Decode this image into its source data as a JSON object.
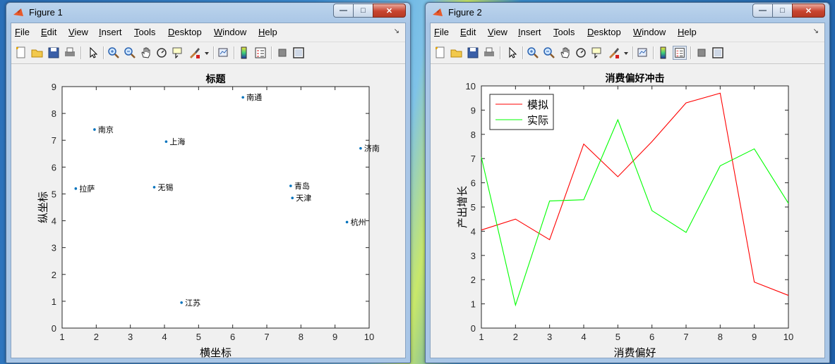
{
  "menu": {
    "items": [
      {
        "key": "F",
        "rest": "ile"
      },
      {
        "key": "E",
        "rest": "dit"
      },
      {
        "key": "V",
        "rest": "iew"
      },
      {
        "key": "I",
        "rest": "nsert"
      },
      {
        "key": "T",
        "rest": "ools"
      },
      {
        "key": "D",
        "rest": "esktop"
      },
      {
        "key": "W",
        "rest": "indow"
      },
      {
        "key": "H",
        "rest": "elp"
      }
    ]
  },
  "window1": {
    "title": "Figure 1",
    "caption": {
      "minimize": "—",
      "maximize": "□",
      "close": "✕"
    }
  },
  "window2": {
    "title": "Figure 2",
    "caption": {
      "minimize": "—",
      "maximize": "□",
      "close": "✕"
    }
  },
  "toolbar_icons": [
    "new-figure-icon",
    "open-file-icon",
    "save-icon",
    "print-icon",
    "edit-plot-arrow-icon",
    "zoom-in-icon",
    "zoom-out-icon",
    "pan-hand-icon",
    "rotate-3d-icon",
    "data-cursor-icon",
    "brush-icon",
    "brush-dropdown-icon",
    "link-plot-icon",
    "colorbar-icon",
    "legend-icon",
    "hide-plot-tools-icon",
    "show-plot-tools-icon"
  ],
  "colors": {
    "series_sim": "#ff0000",
    "series_real": "#00ff00",
    "scatter": "#0072bd",
    "axis": "#262626"
  },
  "chart_data": [
    {
      "type": "scatter",
      "title": "标题",
      "xlabel": "横坐标",
      "ylabel": "纵坐标",
      "xlim": [
        1,
        10
      ],
      "ylim": [
        0,
        9
      ],
      "xticks": [
        1,
        2,
        3,
        4,
        5,
        6,
        7,
        8,
        9,
        10
      ],
      "yticks": [
        0,
        1,
        2,
        3,
        4,
        5,
        6,
        7,
        8,
        9
      ],
      "grid": false,
      "points": [
        {
          "x": 1.4,
          "y": 5.2,
          "label": "拉萨"
        },
        {
          "x": 1.95,
          "y": 7.4,
          "label": "南京"
        },
        {
          "x": 3.7,
          "y": 5.25,
          "label": "无锡"
        },
        {
          "x": 4.05,
          "y": 6.95,
          "label": "上海"
        },
        {
          "x": 4.5,
          "y": 0.95,
          "label": "江苏"
        },
        {
          "x": 6.3,
          "y": 8.6,
          "label": "南通"
        },
        {
          "x": 7.7,
          "y": 5.3,
          "label": "青岛"
        },
        {
          "x": 7.75,
          "y": 4.85,
          "label": "天津"
        },
        {
          "x": 9.35,
          "y": 3.95,
          "label": "杭州"
        },
        {
          "x": 9.75,
          "y": 6.7,
          "label": "济南"
        }
      ]
    },
    {
      "type": "line",
      "title": "消费偏好冲击",
      "xlabel": "消费偏好",
      "ylabel": "产出增长",
      "xlim": [
        1,
        10
      ],
      "ylim": [
        0,
        10
      ],
      "xticks": [
        1,
        2,
        3,
        4,
        5,
        6,
        7,
        8,
        9,
        10
      ],
      "yticks": [
        0,
        1,
        2,
        3,
        4,
        5,
        6,
        7,
        8,
        9,
        10
      ],
      "grid": false,
      "legend_position": "top-left",
      "x": [
        1,
        2,
        3,
        4,
        5,
        6,
        7,
        8,
        9,
        10
      ],
      "series": [
        {
          "name": "模拟",
          "color": "#ff0000",
          "values": [
            4.05,
            4.5,
            3.65,
            7.6,
            6.25,
            7.7,
            9.3,
            9.7,
            1.9,
            1.35
          ]
        },
        {
          "name": "实际",
          "color": "#00ff00",
          "values": [
            7.05,
            0.95,
            5.25,
            5.3,
            8.6,
            4.85,
            3.95,
            6.7,
            7.4,
            5.15
          ]
        }
      ]
    }
  ]
}
